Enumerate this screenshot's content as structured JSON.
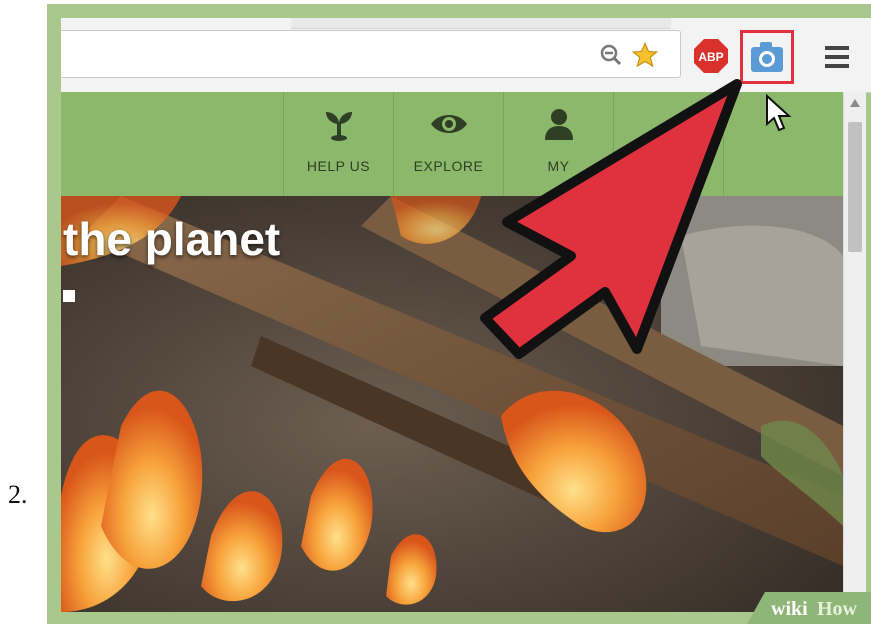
{
  "step": {
    "number": "2."
  },
  "browser": {
    "toolbar_icons": [
      "zoom-out-icon",
      "star-icon",
      "adblock-plus-icon",
      "camera-icon",
      "menu-icon"
    ],
    "abp_label": "ABP",
    "highlight_color": "#e0313f"
  },
  "site": {
    "nav": [
      {
        "label": "HELP US",
        "icon": "sprout-icon"
      },
      {
        "label": "EXPLORE",
        "icon": "eye-icon"
      },
      {
        "label": "MY",
        "icon": "person-icon"
      }
    ],
    "hero_title": "the planet",
    "accent_color": "#8bb86b"
  },
  "watermark": {
    "text_wiki": "wiki",
    "text_how": "How"
  },
  "annotation": {
    "arrow_color": "#e0313f"
  }
}
